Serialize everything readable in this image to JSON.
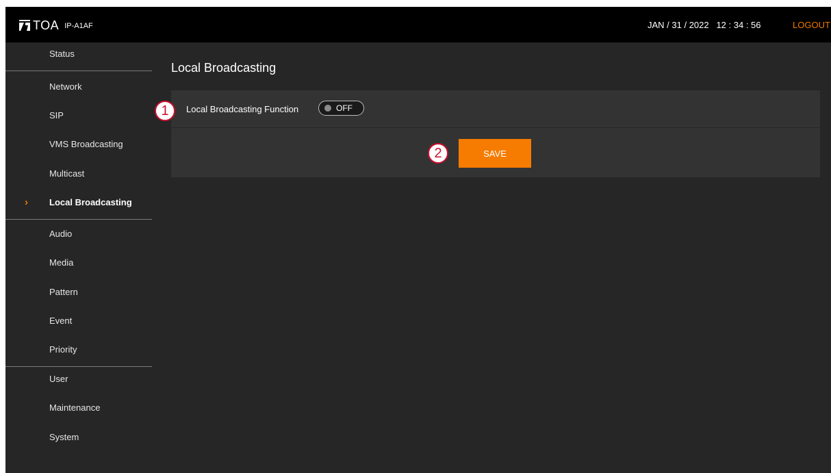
{
  "header": {
    "brand": "TOA",
    "model": "IP-A1AF",
    "datetime": "JAN / 31 / 2022   12 : 34 : 56",
    "logout_label": "LOGOUT"
  },
  "sidebar": {
    "items": [
      {
        "label": "Status"
      },
      {
        "label": "Network"
      },
      {
        "label": "SIP"
      },
      {
        "label": "VMS Broadcasting"
      },
      {
        "label": "Multicast"
      },
      {
        "label": "Local Broadcasting",
        "active": true
      },
      {
        "label": "Audio"
      },
      {
        "label": "Media"
      },
      {
        "label": "Pattern"
      },
      {
        "label": "Event"
      },
      {
        "label": "Priority"
      },
      {
        "label": "User"
      },
      {
        "label": "Maintenance"
      },
      {
        "label": "System"
      }
    ],
    "active_marker": "›"
  },
  "main": {
    "title": "Local Broadcasting",
    "function_label": "Local Broadcasting Function",
    "toggle_state": "OFF",
    "save_label": "SAVE",
    "callouts": [
      "1",
      "2"
    ]
  },
  "colors": {
    "accent": "#f57c00",
    "background": "#262626",
    "header": "#000000",
    "panel": "#333333",
    "callout": "#c8102e"
  }
}
